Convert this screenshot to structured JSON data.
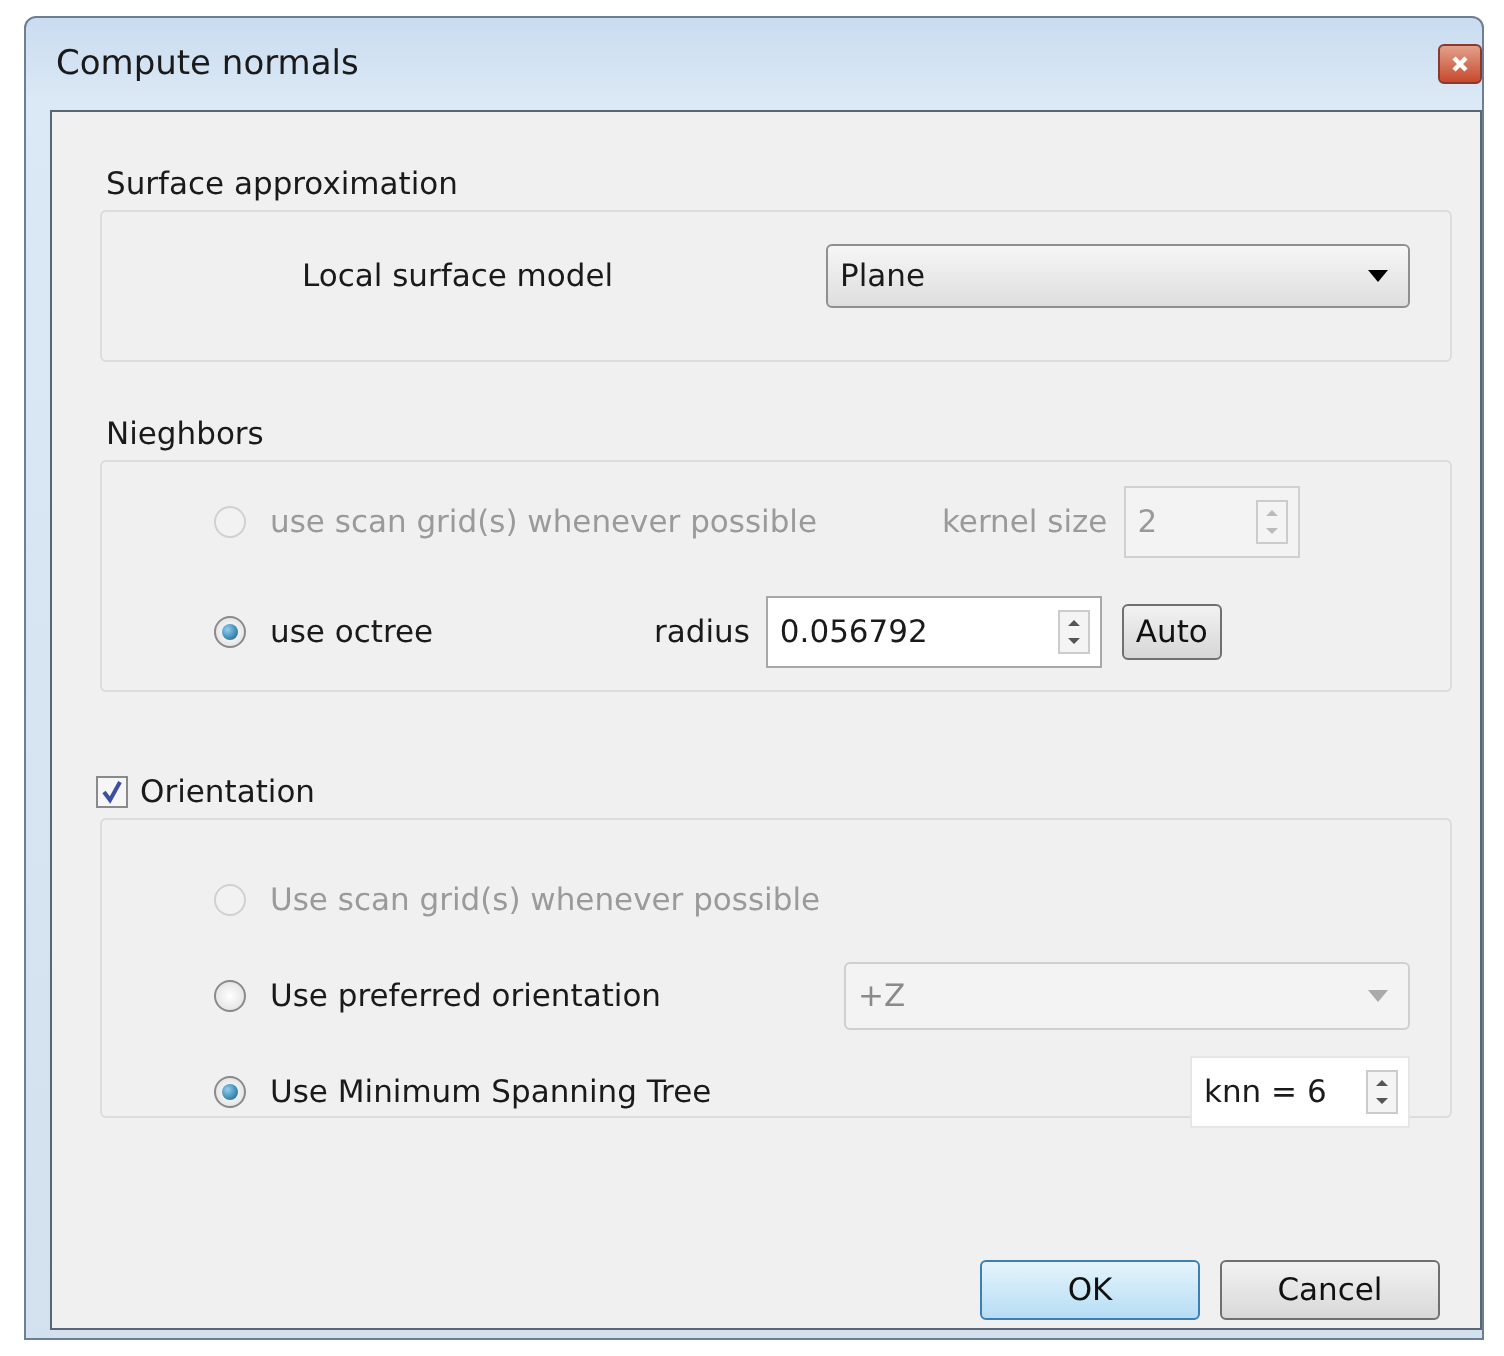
{
  "window": {
    "title": "Compute normals"
  },
  "surface_approximation": {
    "title": "Surface approximation",
    "label": "Local surface model",
    "dropdown": {
      "value": "Plane",
      "disabled": false
    }
  },
  "neighbors": {
    "title": "Nieghbors",
    "options": [
      {
        "label": "use scan grid(s) whenever possible",
        "selected": false,
        "disabled": true,
        "param_label": "kernel size",
        "spin_value": "2"
      },
      {
        "label": "use octree",
        "selected": true,
        "disabled": false,
        "param_label": "radius",
        "spin_value": "0.056792",
        "button": "Auto"
      }
    ]
  },
  "orientation": {
    "title": "Orientation",
    "checked": true,
    "options": [
      {
        "kind": "plain",
        "label": "Use scan grid(s) whenever possible",
        "selected": false,
        "disabled": true
      },
      {
        "kind": "combo",
        "label": "Use preferred orientation",
        "selected": false,
        "disabled": false,
        "combo": {
          "value": "+Z",
          "disabled": true
        }
      },
      {
        "kind": "spin",
        "label": "Use Minimum Spanning Tree",
        "selected": true,
        "disabled": false,
        "spin_value": "knn = 6"
      }
    ]
  },
  "buttons": [
    {
      "label": "OK",
      "default": true
    },
    {
      "label": "Cancel",
      "default": false
    }
  ]
}
